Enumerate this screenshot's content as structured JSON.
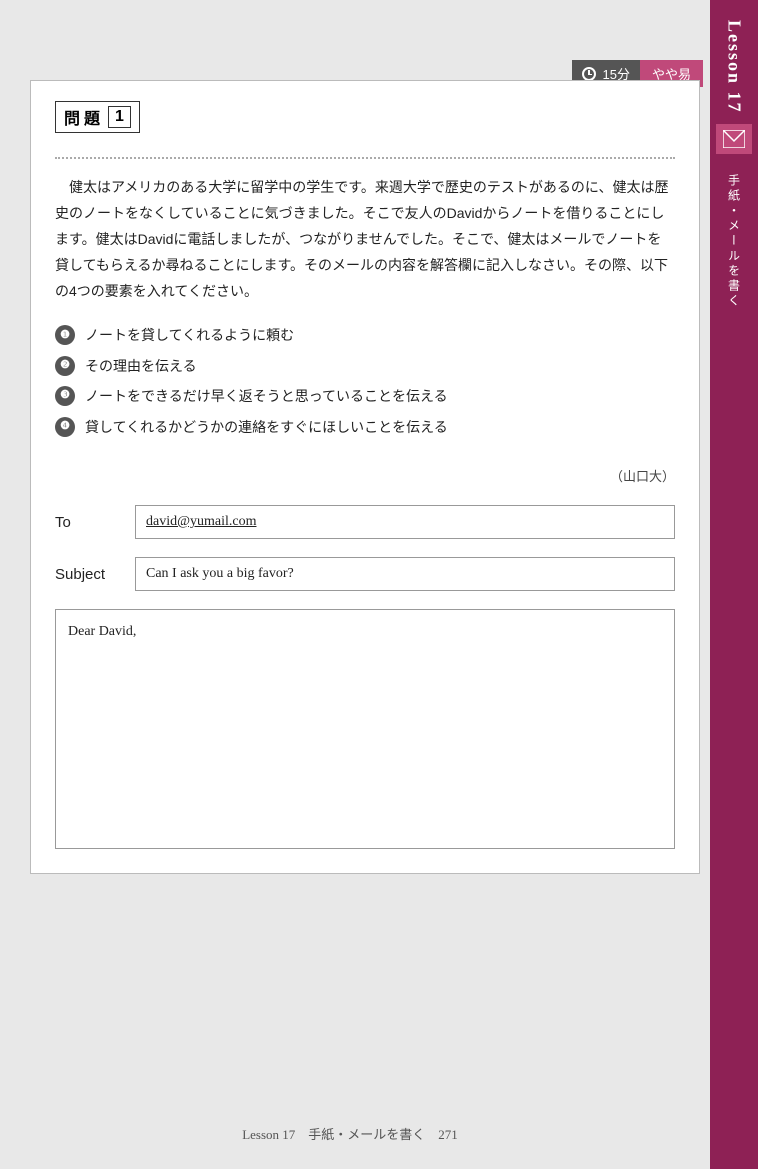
{
  "timer": {
    "icon": "clock-icon",
    "label": "15分"
  },
  "difficulty": {
    "label": "やや易"
  },
  "sidebar": {
    "lesson": "Lesson 17",
    "subtitle": "手紙・メールを書く"
  },
  "problem": {
    "header_label1": "問",
    "header_label2": "題",
    "number": "1",
    "instruction": "　健太はアメリカのある大学に留学中の学生です。来週大学で歴史のテストがあるのに、健太は歴史のノートをなくしていることに気づきました。そこで友人のDavidからノートを借りることにします。健太はDavidに電話しましたが、つながりませんでした。そこで、健太はメールでノートを貸してもらえるか尋ねることにします。そのメールの内容を解答欄に記入しなさい。その際、以下の4つの要素を入れてください。",
    "tasks": [
      "ノートを貸してくれるように頼む",
      "その理由を伝える",
      "ノートをできるだけ早く返そうと思っていることを伝える",
      "貸してくれるかどうかの連絡をすぐにほしいことを伝える"
    ],
    "source": "（山口大）"
  },
  "email": {
    "to_label": "To",
    "to_value": "david@yumail.com",
    "subject_label": "Subject",
    "subject_value": "Can I ask you a big favor?",
    "body_greeting": "Dear David,"
  },
  "footer": {
    "text": "Lesson 17　手紙・メールを書く　271"
  }
}
